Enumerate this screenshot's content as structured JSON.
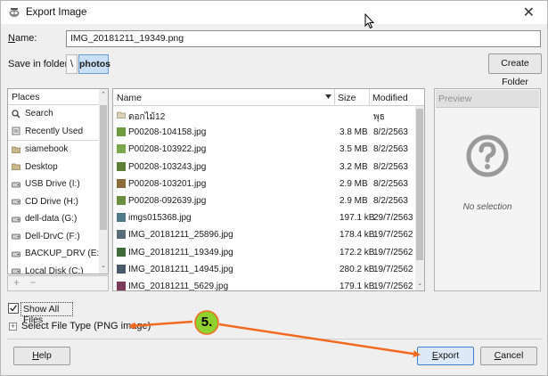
{
  "window": {
    "title": "Export Image",
    "close_glyph": "✕"
  },
  "name_row": {
    "label": "Name:",
    "value": "IMG_20181211_19349.png"
  },
  "folder_row": {
    "label": "Save in folder:",
    "separator": "\\",
    "current": "photos",
    "create_folder": "Create Folder"
  },
  "places": {
    "header": "Places",
    "items": [
      {
        "label": "Search",
        "icon": "search-icon"
      },
      {
        "label": "Recently Used",
        "icon": "recent-icon"
      },
      {
        "label": "siamebook",
        "icon": "folder-icon"
      },
      {
        "label": "Desktop",
        "icon": "folder-icon"
      },
      {
        "label": "USB Drive (I:)",
        "icon": "drive-icon"
      },
      {
        "label": "CD Drive (H:)",
        "icon": "drive-icon"
      },
      {
        "label": "dell-data (G:)",
        "icon": "drive-icon"
      },
      {
        "label": "Dell-DrvC (F:)",
        "icon": "drive-icon"
      },
      {
        "label": "BACKUP_DRV (E:)",
        "icon": "drive-icon"
      },
      {
        "label": "Local Disk (C:)",
        "icon": "drive-icon"
      }
    ],
    "add_glyph": "+",
    "remove_glyph": "−"
  },
  "files": {
    "columns": {
      "name": "Name",
      "size": "Size",
      "modified": "Modified"
    },
    "rows": [
      {
        "name": "ดอกไม้12",
        "size": "",
        "modified": "พุธ",
        "kind": "folder"
      },
      {
        "name": "P00208-104158.jpg",
        "size": "3.8 MB",
        "modified": "8/2/2563",
        "kind": "image"
      },
      {
        "name": "P00208-103922.jpg",
        "size": "3.5 MB",
        "modified": "8/2/2563",
        "kind": "image"
      },
      {
        "name": "P00208-103243.jpg",
        "size": "3.2 MB",
        "modified": "8/2/2563",
        "kind": "image"
      },
      {
        "name": "P00208-103201.jpg",
        "size": "2.9 MB",
        "modified": "8/2/2563",
        "kind": "image"
      },
      {
        "name": "P00208-092639.jpg",
        "size": "2.9 MB",
        "modified": "8/2/2563",
        "kind": "image"
      },
      {
        "name": "imgs015368.jpg",
        "size": "197.1 kB",
        "modified": "29/7/2563",
        "kind": "image"
      },
      {
        "name": "IMG_20181211_25896.jpg",
        "size": "178.4 kB",
        "modified": "19/7/2562",
        "kind": "image"
      },
      {
        "name": "IMG_20181211_19349.jpg",
        "size": "172.2 kB",
        "modified": "19/7/2562",
        "kind": "image"
      },
      {
        "name": "IMG_20181211_14945.jpg",
        "size": "280.2 kB",
        "modified": "19/7/2562",
        "kind": "image"
      },
      {
        "name": "IMG_20181211_5629.jpg",
        "size": "179.1 kB",
        "modified": "19/7/2562",
        "kind": "image"
      }
    ]
  },
  "preview": {
    "header": "Preview",
    "empty_text": "No selection"
  },
  "options": {
    "show_all_files": "Show All Files",
    "select_file_type": "Select File Type (PNG image)"
  },
  "buttons": {
    "help": "Help",
    "export": "Export",
    "cancel": "Cancel"
  },
  "annotation": {
    "step_label": "5.",
    "color": "#f26a21",
    "badge_color": "#8fd12f"
  },
  "colors": {
    "selected_crumb": "#c9dff5",
    "thumb_green": "#5f8a3a",
    "folder": "#c9b98a"
  }
}
